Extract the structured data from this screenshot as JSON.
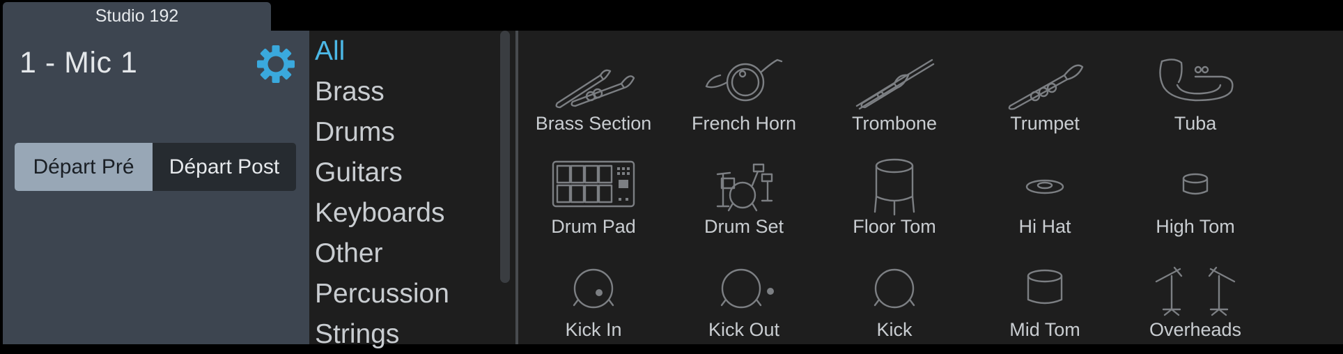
{
  "window": {
    "tab_title": "Studio 192"
  },
  "channel": {
    "name": "1 - Mic 1"
  },
  "send": {
    "pre_label": "Départ Pré",
    "post_label": "Départ Post",
    "active": "pre"
  },
  "categories": [
    "All",
    "Brass",
    "Drums",
    "Guitars",
    "Keyboards",
    "Other",
    "Percussion",
    "Strings"
  ],
  "selected_category": "All",
  "instruments": [
    {
      "label": "Brass Section",
      "icon": "brass-section-icon"
    },
    {
      "label": "French Horn",
      "icon": "french-horn-icon"
    },
    {
      "label": "Trombone",
      "icon": "trombone-icon"
    },
    {
      "label": "Trumpet",
      "icon": "trumpet-icon"
    },
    {
      "label": "Tuba",
      "icon": "tuba-icon"
    },
    {
      "label": "Drum Pad",
      "icon": "drum-pad-icon"
    },
    {
      "label": "Drum Set",
      "icon": "drum-set-icon"
    },
    {
      "label": "Floor Tom",
      "icon": "floor-tom-icon"
    },
    {
      "label": "Hi Hat",
      "icon": "hi-hat-icon"
    },
    {
      "label": "High Tom",
      "icon": "high-tom-icon"
    },
    {
      "label": "Kick In",
      "icon": "kick-in-icon"
    },
    {
      "label": "Kick Out",
      "icon": "kick-out-icon"
    },
    {
      "label": "Kick",
      "icon": "kick-icon"
    },
    {
      "label": "Mid Tom",
      "icon": "mid-tom-icon"
    },
    {
      "label": "Overheads",
      "icon": "overheads-icon"
    }
  ],
  "colors": {
    "accent": "#4cb8e6",
    "panel": "#3d4550",
    "background": "#1e1e1e"
  }
}
